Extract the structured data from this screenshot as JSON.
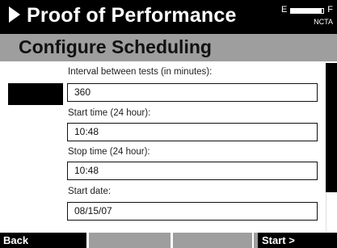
{
  "header": {
    "title": "Proof of Performance",
    "battery": {
      "empty_label": "E",
      "full_label": "F",
      "level": 0.95,
      "mode_label": "NCTA"
    }
  },
  "page": {
    "title": "Configure Scheduling"
  },
  "form": {
    "interval": {
      "label": "Interval between tests (in minutes):",
      "value": "360"
    },
    "start_time": {
      "label": "Start time (24 hour):",
      "value": "10:48"
    },
    "stop_time": {
      "label": "Stop time (24 hour):",
      "value": "10:48"
    },
    "start_date": {
      "label": "Start date:",
      "value": "08/15/07"
    }
  },
  "softkeys": {
    "back": "Back",
    "key2": "",
    "key3": "",
    "key4": "",
    "start": "Start >"
  },
  "colors": {
    "header_bg": "#000000",
    "title_band_bg": "#9e9e9e",
    "softkey_bg": "#9e9e9e"
  },
  "icons": {
    "header_arrow": "play-arrow-icon",
    "battery": "battery-icon"
  }
}
